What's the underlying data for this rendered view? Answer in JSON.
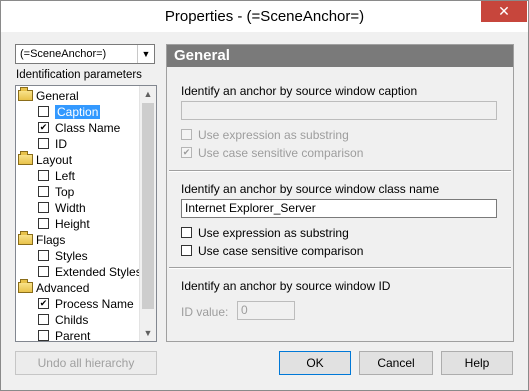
{
  "window": {
    "title": "Properties - (=SceneAnchor=)",
    "close_glyph": "✕"
  },
  "left": {
    "combo_value": "(=SceneAnchor=)",
    "combo_arrow": "▼",
    "params_label": "Identification parameters",
    "tree": [
      {
        "type": "group",
        "label": "General"
      },
      {
        "type": "item",
        "label": "Caption",
        "checked": false,
        "selected": true
      },
      {
        "type": "item",
        "label": "Class Name",
        "checked": true
      },
      {
        "type": "item",
        "label": "ID",
        "checked": false
      },
      {
        "type": "group",
        "label": "Layout"
      },
      {
        "type": "item",
        "label": "Left",
        "checked": false
      },
      {
        "type": "item",
        "label": "Top",
        "checked": false
      },
      {
        "type": "item",
        "label": "Width",
        "checked": false
      },
      {
        "type": "item",
        "label": "Height",
        "checked": false
      },
      {
        "type": "group",
        "label": "Flags"
      },
      {
        "type": "item",
        "label": "Styles",
        "checked": false
      },
      {
        "type": "item",
        "label": "Extended Styles",
        "checked": false
      },
      {
        "type": "group",
        "label": "Advanced"
      },
      {
        "type": "item",
        "label": "Process Name",
        "checked": true
      },
      {
        "type": "item",
        "label": "Childs",
        "checked": false
      },
      {
        "type": "item",
        "label": "Parent",
        "checked": false
      }
    ],
    "scroll_up_glyph": "▲",
    "scroll_down_glyph": "▼",
    "undo_button": "Undo all hierarchy"
  },
  "right": {
    "header": "General",
    "caption_section": {
      "title": "Identify an anchor by source window caption",
      "value": "",
      "opt_substring": "Use expression as substring",
      "opt_substring_checked": false,
      "opt_case": "Use case sensitive comparison",
      "opt_case_checked": true
    },
    "class_section": {
      "title": "Identify an anchor by source window class name",
      "value": "Internet Explorer_Server",
      "opt_substring": "Use expression as substring",
      "opt_substring_checked": false,
      "opt_case": "Use case sensitive comparison",
      "opt_case_checked": false
    },
    "id_section": {
      "title": "Identify an anchor by source window ID",
      "id_label": "ID value:",
      "id_value": "0"
    }
  },
  "buttons": {
    "ok": "OK",
    "cancel": "Cancel",
    "help": "Help"
  },
  "colors": {
    "selection": "#3399ff",
    "header_bg": "#7a7a7a",
    "close_bg": "#c7463c"
  }
}
